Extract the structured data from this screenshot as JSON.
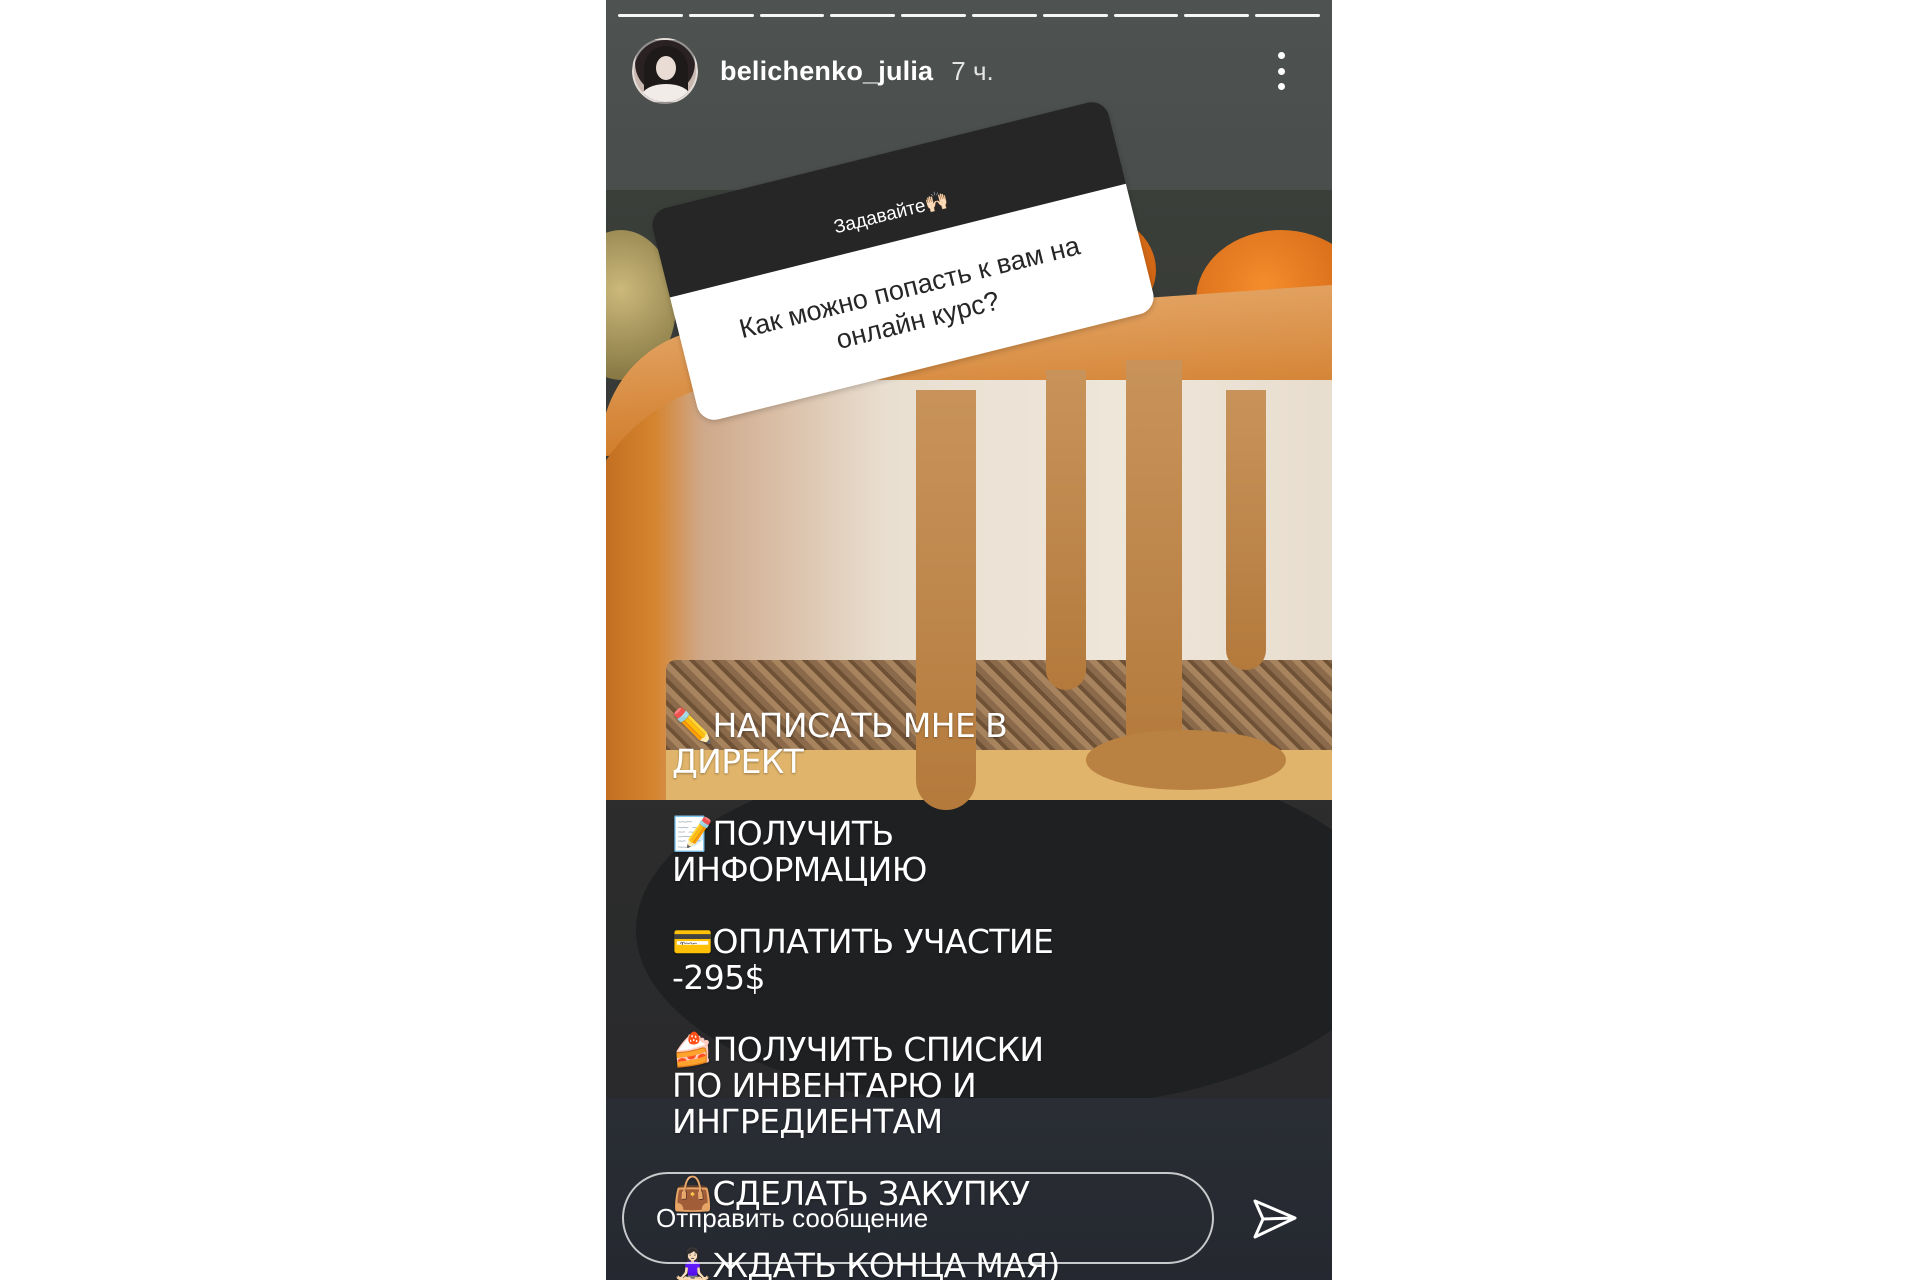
{
  "story": {
    "progress_segments": 10,
    "header": {
      "username": "belichenko_julia",
      "time": "7 ч."
    },
    "question_sticker": {
      "prompt": "Задавайте🙌🏻",
      "question": "Как можно попасть к вам на онлайн курс?"
    },
    "text_lines": [
      "✏️НАПИСАТЬ МНЕ В ДИРЕКТ",
      "📝ПОЛУЧИТЬ ИНФОРМАЦИЮ",
      "💳ОПЛАТИТЬ УЧАСТИЕ -295$",
      "🍰ПОЛУЧИТЬ СПИСКИ ПО ИНВЕНТАРЮ И ИНГРЕДИЕНТАМ",
      "👜СДЕЛАТЬ ЗАКУПКУ",
      "🧘🏻‍♀️ЖДАТЬ КОНЦА МАЯ)"
    ],
    "reply": {
      "placeholder": "Отправить сообщение"
    }
  },
  "icons": {
    "more": "more-vertical-icon",
    "send": "send-icon"
  },
  "colors": {
    "sticker_header": "#262626",
    "sticker_body": "#ffffff",
    "text": "#ffffff"
  }
}
